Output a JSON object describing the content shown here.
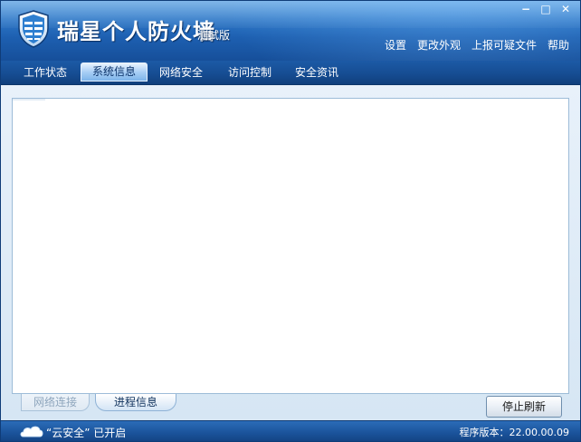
{
  "header": {
    "title": "瑞星个人防火墙",
    "edition": "测试版",
    "window_controls": {
      "minimize": "−",
      "maximize": "□",
      "close": "✕"
    },
    "links": [
      "设置",
      "更改外观",
      "上报可疑文件",
      "帮助"
    ]
  },
  "tabs": [
    {
      "label": "工作状态",
      "active": false
    },
    {
      "label": "系统信息",
      "active": true
    },
    {
      "label": "网络安全",
      "active": false
    },
    {
      "label": "访问控制",
      "active": false
    },
    {
      "label": "安全资讯",
      "active": false
    }
  ],
  "panel": {
    "subtabs": [
      {
        "label": "网络连接",
        "active": false
      },
      {
        "label": "进程信息",
        "active": true
      }
    ],
    "refresh_label": "停止刷新"
  },
  "status": {
    "cloud_text": "“云安全” 已开启",
    "version_text": "程序版本：22.00.00.09"
  },
  "icons": {
    "logo": "shield-icon",
    "cloud": "cloud-icon"
  },
  "colors": {
    "header_blue": "#1d5fb0",
    "tab_active": "#a9cff5",
    "panel_border": "#9dbcd8"
  }
}
